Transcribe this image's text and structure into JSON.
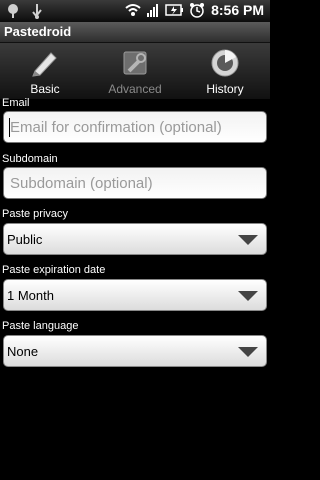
{
  "status_bar": {
    "time": "8:56 PM",
    "icons": [
      "notification-icon",
      "usb-icon",
      "wifi-icon",
      "signal-icon",
      "battery-icon",
      "alarm-icon"
    ]
  },
  "app": {
    "title": "Pastedroid"
  },
  "tabs": [
    {
      "label": "Basic",
      "icon": "pencil-icon",
      "state": "active"
    },
    {
      "label": "Advanced",
      "icon": "settings-wrench-icon",
      "state": "disabled"
    },
    {
      "label": "History",
      "icon": "history-dial-icon",
      "state": "normal"
    }
  ],
  "form": {
    "email": {
      "label": "Email",
      "placeholder": "Email for confirmation (optional)"
    },
    "subdomain": {
      "label": "Subdomain",
      "placeholder": "Subdomain (optional)"
    },
    "privacy": {
      "label": "Paste privacy",
      "value": "Public"
    },
    "expiration": {
      "label": "Paste expiration date",
      "value": "1 Month"
    },
    "language": {
      "label": "Paste language",
      "value": "None"
    }
  }
}
